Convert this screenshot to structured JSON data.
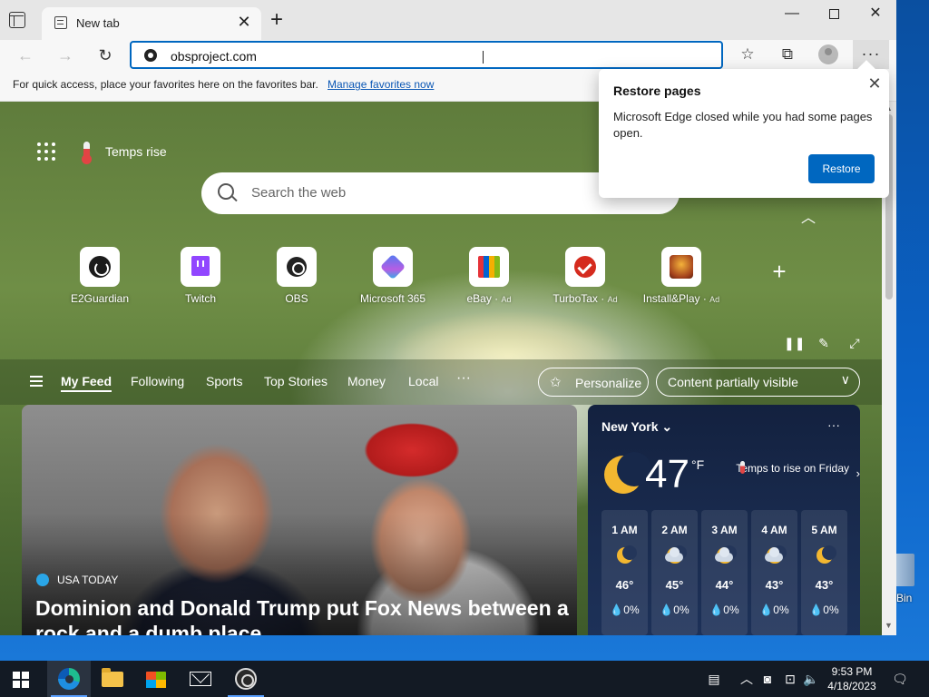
{
  "browser": {
    "tab": {
      "title": "New tab",
      "close": "✕"
    },
    "new_tab": "+",
    "window_controls": {
      "minimize": "—",
      "maximize": "",
      "close": "✕"
    },
    "nav": {
      "back": "←",
      "forward": "→",
      "reload": "↻"
    },
    "address": {
      "value": "obsproject.com"
    },
    "toolbar_icons": {
      "favorites": "☆",
      "collections": "⧉",
      "more": "···"
    },
    "favorites_bar": {
      "text": "For quick access, place your favorites here on the favorites bar.",
      "link": "Manage favorites now"
    }
  },
  "newtab": {
    "weather_pill": "Temps rise",
    "search": {
      "placeholder": "Search the web"
    },
    "collapse": "︿",
    "quick_links": [
      {
        "label": "E2Guardian",
        "ad": "",
        "icon": "github-icon"
      },
      {
        "label": "Twitch",
        "ad": "",
        "icon": "twitch-icon"
      },
      {
        "label": "OBS",
        "ad": "",
        "icon": "obs-icon"
      },
      {
        "label": "Microsoft 365",
        "ad": "",
        "icon": "microsoft365-icon"
      },
      {
        "label": "eBay",
        "ad": "Ad",
        "icon": "ebay-icon"
      },
      {
        "label": "TurboTax",
        "ad": "Ad",
        "icon": "turbotax-icon"
      },
      {
        "label": "Install&Play",
        "ad": "Ad",
        "icon": "installplay-icon"
      }
    ],
    "add_link": "+",
    "bg_controls": {
      "pause": "❚❚",
      "edit": "✎",
      "expand": "⤢"
    },
    "feed": {
      "tabs": [
        "My Feed",
        "Following",
        "Sports",
        "Top Stories",
        "Money",
        "Local"
      ],
      "more": "···",
      "personalize": "Personalize",
      "personalize_icon": "✩",
      "content_visibility": "Content partially visible",
      "content_visibility_chevron": "∨"
    },
    "news": {
      "source": "USA TODAY",
      "headline": "Dominion and Donald Trump put Fox News between a rock and a dumb place"
    },
    "weather": {
      "city": "New York ⌄",
      "more": "···",
      "temp": "47",
      "unit": "°F",
      "alert": "Temps to rise on Friday",
      "alert_chevron": "›",
      "hours": [
        {
          "time": "1 AM",
          "icon": "moon-icon",
          "temp": "46°",
          "precip": "💧0%"
        },
        {
          "time": "2 AM",
          "icon": "cloudy-moon-icon",
          "temp": "45°",
          "precip": "💧0%"
        },
        {
          "time": "3 AM",
          "icon": "cloudy-moon-icon",
          "temp": "44°",
          "precip": "💧0%"
        },
        {
          "time": "4 AM",
          "icon": "cloudy-moon-icon",
          "temp": "43°",
          "precip": "💧0%"
        },
        {
          "time": "5 AM",
          "icon": "moon-icon",
          "temp": "43°",
          "precip": "💧0%"
        }
      ]
    }
  },
  "popup": {
    "title": "Restore pages",
    "body": "Microsoft Edge closed while you had some pages open.",
    "button": "Restore",
    "close": "✕"
  },
  "scrollbar": {
    "up": "▲",
    "down": "▼"
  },
  "desktop": {
    "recycle_bin_label": "Bin"
  },
  "taskbar": {
    "apps": [
      {
        "name": "edge",
        "state": "active"
      },
      {
        "name": "file-explorer",
        "state": ""
      },
      {
        "name": "microsoft-store",
        "state": ""
      },
      {
        "name": "mail",
        "state": ""
      },
      {
        "name": "obs",
        "state": "running"
      }
    ],
    "tray": {
      "news": "▤",
      "chevron": "︿",
      "meet": "◙",
      "network": "⊡",
      "volume": "🔈",
      "notifications": "🗨"
    },
    "time": "9:53 PM",
    "date": "4/18/2023"
  },
  "colors": {
    "accent": "#0067c0",
    "taskbar": "#131a24",
    "weather_card": "#1a2c50"
  }
}
